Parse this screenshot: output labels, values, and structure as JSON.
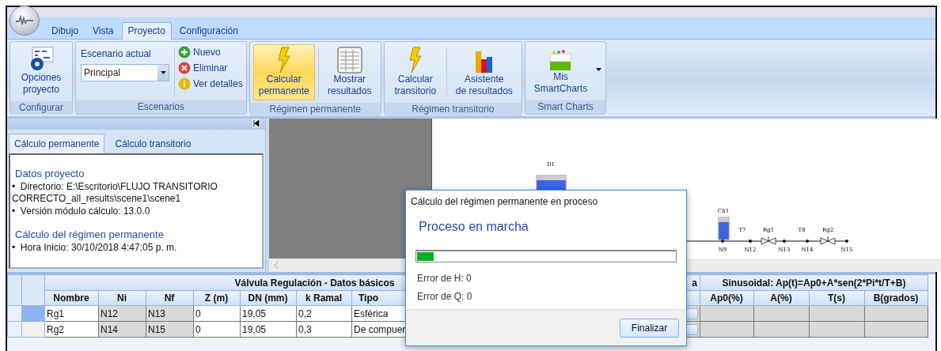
{
  "ribbon": {
    "tabs": [
      {
        "label": "Dibujo",
        "selected": false
      },
      {
        "label": "Vista",
        "selected": false
      },
      {
        "label": "Proyecto",
        "selected": true
      },
      {
        "label": "Configuración",
        "selected": false
      }
    ],
    "groups": [
      {
        "label": "Configurar",
        "items": [
          {
            "kind": "large",
            "label": "Opciones\nproyecto",
            "highlighted": false
          }
        ]
      },
      {
        "label": "Escenarios",
        "items": [
          {
            "kind": "combo",
            "label": "Escenario actual",
            "value": "Principal"
          },
          {
            "kind": "small",
            "label": "Nuevo"
          },
          {
            "kind": "small",
            "label": "Eliminar"
          },
          {
            "kind": "small",
            "label": "Ver detalles"
          }
        ]
      },
      {
        "label": "Régimen permanente",
        "items": [
          {
            "kind": "large",
            "label": "Calcular\npermanente",
            "highlighted": true
          },
          {
            "kind": "large",
            "label": "Mostrar\nresultados",
            "highlighted": false
          }
        ]
      },
      {
        "label": "Régimen transitorio",
        "items": [
          {
            "kind": "large",
            "label": "Calcular\ntransitorio",
            "highlighted": false
          },
          {
            "kind": "large",
            "label": "Asistente\nde resultados",
            "highlighted": false
          }
        ]
      },
      {
        "label": "Smart Charts",
        "items": [
          {
            "kind": "large",
            "label": "Mis\nSmartCharts",
            "highlighted": false,
            "dropdown": true
          }
        ]
      }
    ]
  },
  "left_panel": {
    "tabs": [
      {
        "label": "Cálculo permanente",
        "selected": true
      },
      {
        "label": "Cálculo transitorio",
        "selected": false
      }
    ],
    "sections": [
      {
        "heading": "Datos proyecto",
        "bullets": [
          "•  Directorio: E:\\Escritorio\\FLUJO TRANSITORIO CORRECTO_all_results\\scene1\\scene1",
          "•  Versión módulo cálculo: 13.0.0"
        ]
      },
      {
        "heading": "Cálculo del régimen permanente",
        "bullets": [
          "•  Hora Inicio: 30/10/2018 4:47:05 p. m."
        ]
      }
    ]
  },
  "diagram": {
    "tanks": [
      {
        "label": "D1"
      },
      {
        "label": "Ch1"
      }
    ],
    "pipes": [
      {
        "label": "T7"
      },
      {
        "label": "T8"
      }
    ],
    "valves": [
      {
        "label": "Rg1"
      },
      {
        "label": "Rg2"
      }
    ],
    "nodes": [
      {
        "label": "N9"
      },
      {
        "label": "N12"
      },
      {
        "label": "N13"
      },
      {
        "label": "N14"
      },
      {
        "label": "N15"
      }
    ]
  },
  "table": {
    "groups": [
      "Válvula Regulación - Datos básicos",
      "a",
      "Sinusoidal: Ap(t)=Ap0+A*sen(2*Pi*t/T+B)"
    ],
    "columns": [
      "Nombre",
      "Ni",
      "Nf",
      "Z (m)",
      "DN (mm)",
      "k Ramal",
      "Tipo",
      "Ap0(%)",
      "A(%)",
      "T(s)",
      "B(grados)"
    ],
    "rows": [
      {
        "selected": true,
        "cells": [
          "Rg1",
          "N12",
          "N13",
          "0",
          "19,05",
          "0,2",
          "Esférica"
        ]
      },
      {
        "selected": false,
        "cells": [
          "Rg2",
          "N14",
          "N15",
          "0",
          "19,05",
          "0,3",
          "De compuer"
        ]
      }
    ]
  },
  "dialog": {
    "title": "Cálculo del régimen permanente en proceso",
    "heading": "Proceso en marcha",
    "level": 0.065,
    "lines": [
      "Error de H: 0",
      "Error de Q: 0"
    ],
    "button": "Finalizar"
  }
}
